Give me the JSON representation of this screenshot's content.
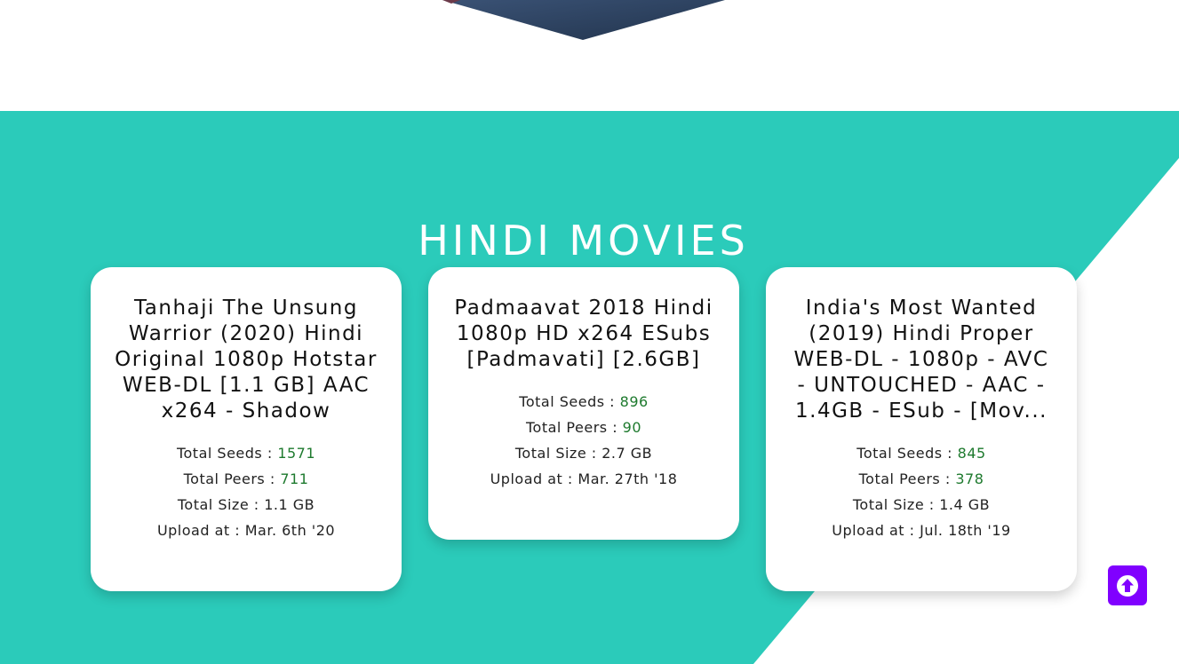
{
  "section": {
    "title": "HINDI MOVIES"
  },
  "cards": [
    {
      "title": "Tanhaji The Unsung Warrior (2020) Hindi Original 1080p Hotstar WEB-DL [1.1 GB] AAC x264 - Shadow",
      "seeds_label": "Total Seeds : ",
      "seeds": "1571",
      "peers_label": "Total Peers : ",
      "peers": "711",
      "size_label": "Total Size : ",
      "size": "1.1 GB",
      "upload_label": "Upload at : ",
      "upload": "Mar. 6th '20"
    },
    {
      "title": "Padmaavat 2018 Hindi 1080p HD x264 ESubs [Padmavati] [2.6GB]",
      "seeds_label": "Total Seeds : ",
      "seeds": "896",
      "peers_label": "Total Peers : ",
      "peers": "90",
      "size_label": "Total Size : ",
      "size": "2.7 GB",
      "upload_label": "Upload at : ",
      "upload": "Mar. 27th '18"
    },
    {
      "title": "India's Most Wanted (2019) Hindi Proper WEB-DL - 1080p - AVC - UNTOUCHED - AAC - 1.4GB - ESub - [Mov...",
      "seeds_label": "Total Seeds : ",
      "seeds": "845",
      "peers_label": "Total Peers : ",
      "peers": "378",
      "size_label": "Total Size : ",
      "size": "1.4 GB",
      "upload_label": "Upload at : ",
      "upload": "Jul. 18th '19"
    }
  ],
  "scroll_top_icon": "arrow-up-circle-icon",
  "colors": {
    "accent_teal": "#2bcbba",
    "seed_green": "#1e7a2e",
    "scroll_button": "#8000ff"
  }
}
